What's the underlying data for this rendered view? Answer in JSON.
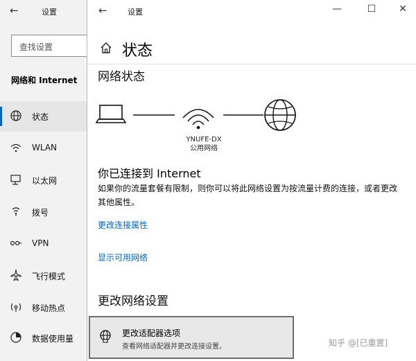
{
  "back_window": {
    "title": "设置",
    "search_placeholder": "查找设置",
    "section": "网络和 Internet",
    "nav": [
      {
        "label": "状态",
        "icon": "globe-icon",
        "selected": true
      },
      {
        "label": "WLAN",
        "icon": "wifi-icon",
        "selected": false
      },
      {
        "label": "以太网",
        "icon": "ethernet-icon",
        "selected": false
      },
      {
        "label": "拨号",
        "icon": "dialup-icon",
        "selected": false
      },
      {
        "label": "VPN",
        "icon": "vpn-icon",
        "selected": false
      },
      {
        "label": "飞行模式",
        "icon": "airplane-icon",
        "selected": false
      },
      {
        "label": "移动热点",
        "icon": "hotspot-icon",
        "selected": false
      },
      {
        "label": "数据使用量",
        "icon": "data-usage-icon",
        "selected": false
      }
    ]
  },
  "front_window": {
    "title": "设置",
    "page_title": "状态",
    "network_status_heading": "网络状态",
    "network_name": "YNUFE-DX",
    "network_type": "公用网络",
    "connected_title": "你已连接到 Internet",
    "description": "如果你的流量套餐有限制，则你可以将此网络设置为按流量计费的连接，或者更改其他属性。",
    "link_change_props": "更改连接属性",
    "link_show_networks": "显示可用网络",
    "change_settings_heading": "更改网络设置",
    "adapter_title": "更改适配器选项",
    "adapter_desc": "查看网络适配器并更改连接设置。"
  },
  "watermark": "知乎 @[已重置]",
  "accent_color": "#0067c0"
}
